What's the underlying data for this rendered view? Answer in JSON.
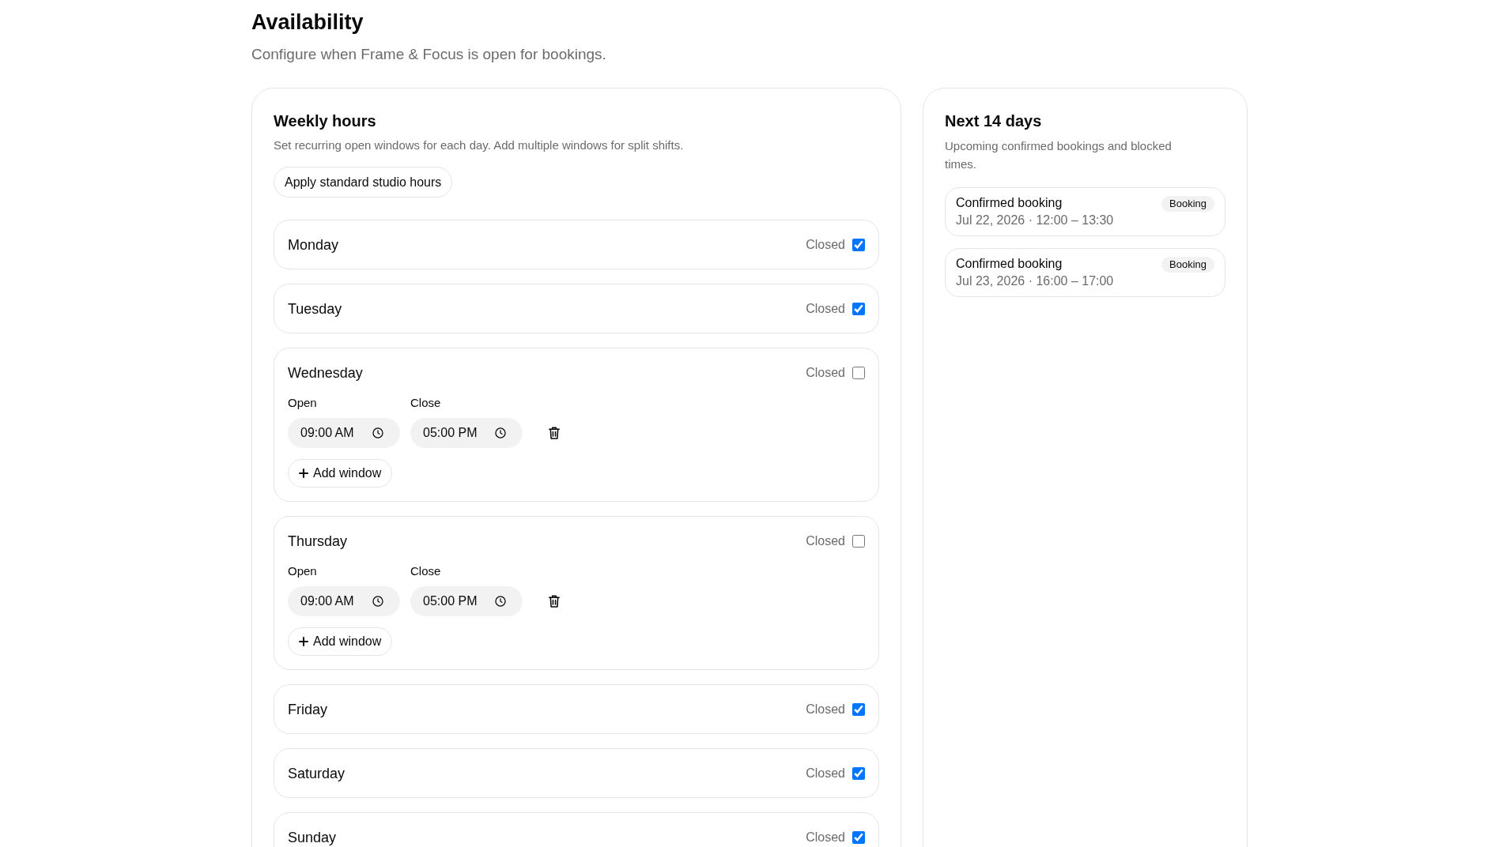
{
  "page": {
    "title": "Availability",
    "subtitle": "Configure when Frame & Focus is open for bookings."
  },
  "weekly_hours": {
    "title": "Weekly hours",
    "description": "Set recurring open windows for each day. Add multiple windows for split shifts.",
    "apply_button": "Apply standard studio hours",
    "days": [
      {
        "name": "Monday",
        "closed_label": "Closed",
        "closed": true
      },
      {
        "name": "Tuesday",
        "closed_label": "Closed",
        "closed": true
      },
      {
        "name": "Wednesday",
        "closed_label": "Closed",
        "closed": false,
        "windows": [
          {
            "open_label": "Open",
            "open": "09:00 AM",
            "close_label": "Close",
            "close": "05:00 PM"
          }
        ],
        "add_window_button": "Add window"
      },
      {
        "name": "Thursday",
        "closed_label": "Closed",
        "closed": false,
        "windows": [
          {
            "open_label": "Open",
            "open": "09:00 AM",
            "close_label": "Close",
            "close": "05:00 PM"
          }
        ],
        "add_window_button": "Add window"
      },
      {
        "name": "Friday",
        "closed_label": "Closed",
        "closed": true
      },
      {
        "name": "Saturday",
        "closed_label": "Closed",
        "closed": true
      },
      {
        "name": "Sunday",
        "closed_label": "Closed",
        "closed": true
      }
    ]
  },
  "next_14_days": {
    "title": "Next 14 days",
    "description": "Upcoming confirmed bookings and blocked times.",
    "items": [
      {
        "title": "Confirmed booking",
        "when": "Jul 22, 2026 · 12:00 – 13:30",
        "badge": "Booking"
      },
      {
        "title": "Confirmed booking",
        "when": "Jul 23, 2026 · 16:00 – 17:00",
        "badge": "Booking"
      }
    ]
  }
}
